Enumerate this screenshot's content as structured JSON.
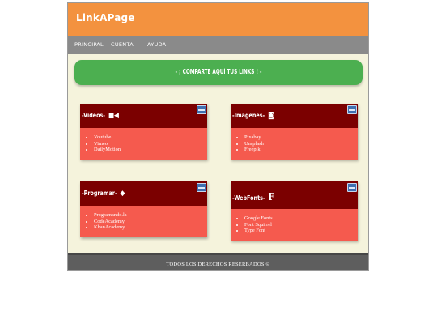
{
  "brand": {
    "logo": "LinkAPage"
  },
  "nav": {
    "items": [
      "PRINCIPAL",
      "CUENTA",
      "AYUDA"
    ]
  },
  "banner": {
    "text": "- ¡ COMPARTE AQUÍ TUS LINKS ! -"
  },
  "cards": [
    {
      "title": "-Videos-",
      "icon": "video-camera-icon",
      "links": [
        "Youtube",
        "Vimeo",
        "DailyMotion"
      ]
    },
    {
      "title": "-Imagenes-",
      "icon": "camera-icon",
      "links": [
        "Pixabay",
        "Unsplash",
        "Freepik"
      ]
    },
    {
      "title": "-Programar-",
      "icon": "diamond-icon",
      "links": [
        "Programando.la",
        "CodeAcademy",
        "KhanAcademy"
      ]
    },
    {
      "title": "-WebFonts-",
      "icon": "font-icon",
      "links": [
        "Google Fonts",
        "Font Squirrel",
        "Type Font"
      ]
    }
  ],
  "footer": {
    "text": "TODOS LOS DERECHOS RESERBADOS ©"
  },
  "colors": {
    "header": "#f3923f",
    "nav": "#8a8a8a",
    "banner": "#4caf50",
    "card_head": "#7b0000",
    "card_body": "#f55a4e",
    "footer": "#5e5e5e",
    "page_bg": "#f5f3dc"
  }
}
